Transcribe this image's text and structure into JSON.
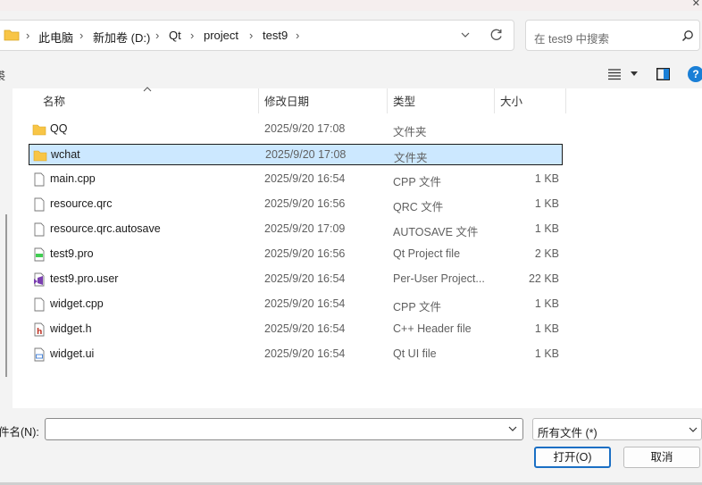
{
  "address": {
    "crumbs": [
      "此电脑",
      "新加卷 (D:)",
      "Qt",
      "project",
      "test9"
    ],
    "separator": "›"
  },
  "search": {
    "placeholder": "在 test9 中搜索"
  },
  "toolbar": {
    "left_fragment": "裘",
    "help_label": "?"
  },
  "columns": {
    "name": "名称",
    "date": "修改日期",
    "type": "类型",
    "size": "大小"
  },
  "files": [
    {
      "icon": "folder-icon",
      "name": "QQ",
      "date": "2025/9/20 17:08",
      "type": "文件夹",
      "size": ""
    },
    {
      "icon": "folder-icon",
      "name": "wchat",
      "date": "2025/9/20 17:08",
      "type": "文件夹",
      "size": "",
      "selected": true
    },
    {
      "icon": "document-icon",
      "name": "main.cpp",
      "date": "2025/9/20 16:54",
      "type": "CPP 文件",
      "size": "1 KB"
    },
    {
      "icon": "document-icon",
      "name": "resource.qrc",
      "date": "2025/9/20 16:56",
      "type": "QRC 文件",
      "size": "1 KB"
    },
    {
      "icon": "document-icon",
      "name": "resource.qrc.autosave",
      "date": "2025/9/20 17:09",
      "type": "AUTOSAVE 文件",
      "size": "1 KB"
    },
    {
      "icon": "qt-project-icon",
      "name": "test9.pro",
      "date": "2025/9/20 16:56",
      "type": "Qt Project file",
      "size": "2 KB"
    },
    {
      "icon": "visual-studio-icon",
      "name": "test9.pro.user",
      "date": "2025/9/20 16:54",
      "type": "Per-User Project...",
      "size": "22 KB"
    },
    {
      "icon": "document-icon",
      "name": "widget.cpp",
      "date": "2025/9/20 16:54",
      "type": "CPP 文件",
      "size": "1 KB"
    },
    {
      "icon": "header-file-icon",
      "name": "widget.h",
      "date": "2025/9/20 16:54",
      "type": "C++ Header file",
      "size": "1 KB"
    },
    {
      "icon": "ui-file-icon",
      "name": "widget.ui",
      "date": "2025/9/20 16:54",
      "type": "Qt UI file",
      "size": "1 KB"
    }
  ],
  "bottom": {
    "filename_label": "件名(N):",
    "filename_value": "",
    "filter_value": "所有文件 (*)",
    "open_label": "打开(O)",
    "cancel_label": "取消"
  },
  "colors": {
    "selection_bg": "#cce8ff",
    "folder": "#f8c546",
    "accent": "#1a7fd6"
  }
}
